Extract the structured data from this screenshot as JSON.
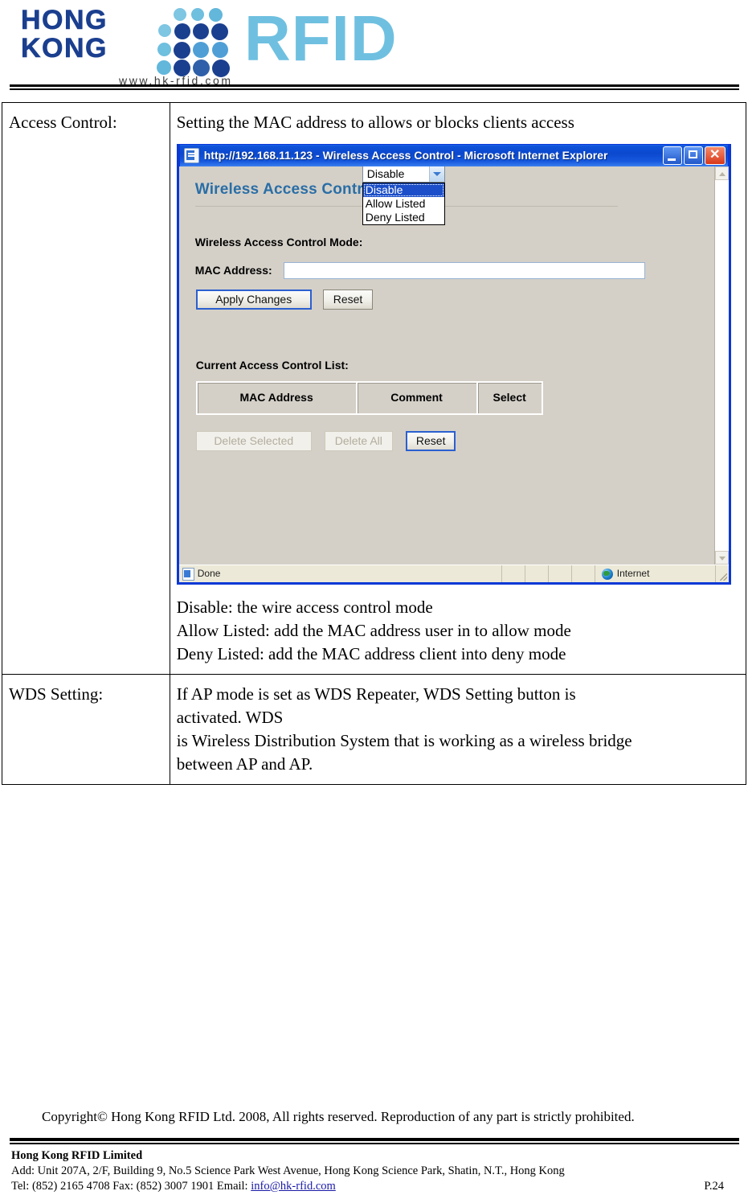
{
  "header": {
    "logo": {
      "line1": "HONG",
      "line2": "KONG",
      "brand": "RFID",
      "url": "www.hk-rfid.com"
    }
  },
  "doc_table": {
    "rows": [
      {
        "label": "Access Control:",
        "intro": "Setting the MAC address to allows or blocks clients access",
        "mode_lines": [
          "Disable: the wire access control mode",
          "Allow Listed: add the MAC address user in to allow mode",
          "Deny Listed: add the MAC address client into deny mode"
        ]
      },
      {
        "label": "WDS Setting:",
        "paragraph_lines": [
          "If AP mode is set as WDS Repeater, WDS Setting button is",
          "activated. WDS",
          "is Wireless Distribution System that is working as a wireless bridge",
          "between AP and AP."
        ]
      }
    ]
  },
  "browser": {
    "title": "http://192.168.11.123 - Wireless Access Control - Microsoft Internet Explorer",
    "window_buttons": {
      "minimize": "Minimize",
      "maximize": "Maximize",
      "close": "Close"
    },
    "page": {
      "heading": "Wireless Access Control",
      "form": {
        "mode_label": "Wireless Access Control Mode:",
        "mode_value": "Disable",
        "mode_options": [
          "Disable",
          "Allow Listed",
          "Deny Listed"
        ],
        "mac_label": "MAC Address:",
        "mac_value": "",
        "mac_placeholder": "",
        "apply_label": "Apply Changes",
        "reset_label": "Reset"
      },
      "acl": {
        "list_label": "Current Access Control List:",
        "columns": [
          "MAC Address",
          "Comment",
          "Select"
        ],
        "rows": [],
        "delete_selected_label": "Delete Selected",
        "delete_all_label": "Delete All",
        "reset_label": "Reset"
      }
    },
    "statusbar": {
      "status": "Done",
      "zone": "Internet"
    }
  },
  "footer": {
    "copyright": "Copyright© Hong Kong RFID Ltd. 2008, All rights reserved. Reproduction of any part is strictly prohibited.",
    "company": "Hong Kong RFID Limited",
    "address": "Add: Unit 207A, 2/F, Building 9, No.5 Science Park West Avenue, Hong Kong Science Park, Shatin, N.T., Hong Kong",
    "contact_prefix": "Tel: (852) 2165 4708   Fax: (852) 3007 1901   Email: ",
    "email": "info@hk-rfid.com",
    "page_number": "P.24"
  },
  "colors": {
    "brand_navy": "#1b3f8f",
    "brand_lightblue": "#6fc0e0",
    "page_heading": "#2a6ea6",
    "titlebar_blue": "#0b49cf",
    "select_highlight": "#1b4ec8"
  }
}
